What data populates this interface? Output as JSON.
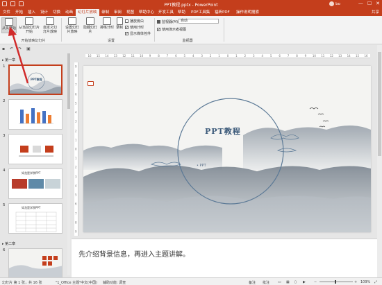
{
  "window": {
    "title": "PPT教程.pptx  -  PowerPoint",
    "user": "bo",
    "minimize": "—",
    "maximize": "☐",
    "close": "✕"
  },
  "tabs": [
    {
      "label": "文件"
    },
    {
      "label": "开始"
    },
    {
      "label": "插入"
    },
    {
      "label": "设计"
    },
    {
      "label": "切换"
    },
    {
      "label": "动画"
    },
    {
      "label": "幻灯片放映"
    },
    {
      "label": "录制"
    },
    {
      "label": "审阅"
    },
    {
      "label": "视图"
    },
    {
      "label": "帮助中心"
    },
    {
      "label": "开发工具"
    },
    {
      "label": "帮助"
    },
    {
      "label": "PDF工具集"
    },
    {
      "label": "福昕PDF"
    },
    {
      "label": "操作说明搜索"
    }
  ],
  "share_label": "共享",
  "ribbon": {
    "from_start": "从头开始",
    "from_current": "从当前幻灯片开始",
    "custom": "自定义幻灯片放映",
    "group_start": "开始放映幻灯片",
    "setup": "设置幻灯片放映",
    "hide": "隐藏幻灯片",
    "rehearse": "排练计时",
    "record": "录制",
    "chk_narration": "播放旁白",
    "chk_timing": "使用计时",
    "chk_media": "显示媒体控件",
    "group_setup": "设置",
    "monitor_label": "监视器(M):",
    "monitor_value": "自动",
    "presenter_view": "使用演示者视图",
    "group_monitor": "监视器"
  },
  "left_pane": {
    "section1": "第一章",
    "section2": "第二章",
    "thumbs": [
      {
        "num": "1"
      },
      {
        "num": "2"
      },
      {
        "num": "3"
      },
      {
        "num": "4"
      },
      {
        "num": "5"
      },
      {
        "num": "6"
      }
    ],
    "thumb4_title": "如龙是学院PPT",
    "thumb5_title": "如龙是学院PPT"
  },
  "ruler_h": [
    "16",
    "15",
    "14",
    "13",
    "12",
    "11",
    "10",
    "9",
    "8",
    "7",
    "6",
    "5",
    "4",
    "3",
    "2",
    "1",
    "0",
    "1",
    "2",
    "3",
    "4",
    "5",
    "6",
    "7",
    "8",
    "9",
    "10",
    "11",
    "12",
    "13",
    "14",
    "15",
    "16"
  ],
  "ruler_v": [
    "9",
    "8",
    "7",
    "6",
    "5",
    "4",
    "3",
    "2",
    "1",
    "0",
    "1",
    "2",
    "3",
    "4",
    "5",
    "6",
    "7",
    "8",
    "9"
  ],
  "slide": {
    "title": "PPT教程",
    "subtitle": "• PPT"
  },
  "notes": {
    "text": "先介绍背景信息，再进入主题讲解。"
  },
  "status": {
    "slide_count": "幻灯片 第 1 张，共 16 张",
    "theme": "\"1_Office 主题\"",
    "language": "中文(中国)",
    "accessibility": "辅助功能: 调查",
    "notes_btn": "备注",
    "comments_btn": "批注",
    "zoom": "109%"
  },
  "colors": {
    "accent": "#c43e1c",
    "annotation": "#d12b2b"
  }
}
